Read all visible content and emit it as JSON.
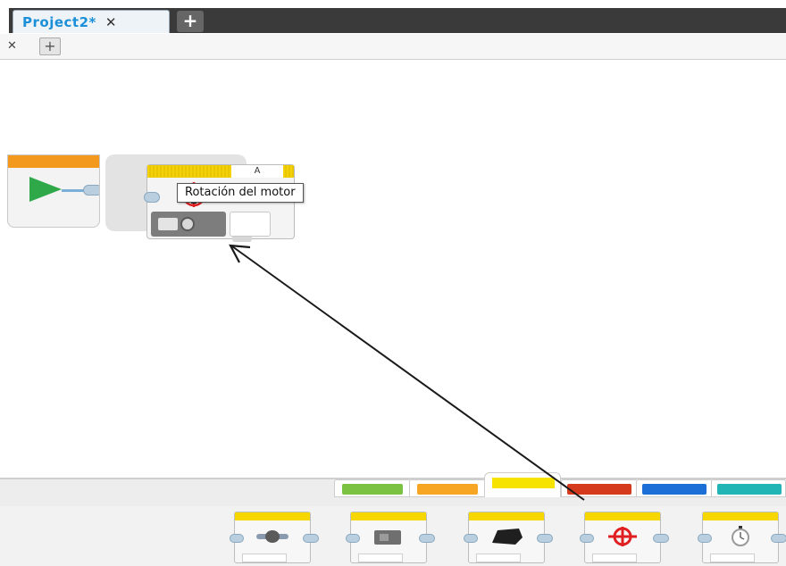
{
  "project_tabs": {
    "active_label": "Project2*",
    "close_glyph": "✕",
    "add_glyph": "+"
  },
  "program_tabs": {
    "close_glyph": "✕",
    "add_glyph": "+"
  },
  "canvas": {
    "start_block": {
      "icon": "play-icon"
    },
    "motor_block": {
      "port_label": "A",
      "icon": "motor-rotation-sensor-icon",
      "tooltip": "Rotación del motor"
    }
  },
  "palette": {
    "category_tabs": [
      {
        "name": "action",
        "color": "#7cc242"
      },
      {
        "name": "flow",
        "color": "#f6a623"
      },
      {
        "name": "sensor",
        "color": "#f6e400",
        "active": true
      },
      {
        "name": "data",
        "color": "#d63a1c"
      },
      {
        "name": "advanced",
        "color": "#1c6fd6"
      },
      {
        "name": "myblocks",
        "color": "#22b5b5"
      }
    ],
    "blocks": [
      {
        "icon": "brick-buttons-sensor-icon"
      },
      {
        "icon": "color-sensor-icon"
      },
      {
        "icon": "infrared-sensor-icon"
      },
      {
        "icon": "motor-rotation-sensor-icon"
      },
      {
        "icon": "timer-sensor-icon"
      }
    ]
  },
  "colors": {
    "accent_blue": "#1b8fd8",
    "start_orange": "#f39a1e",
    "play_green": "#2fa84a",
    "sensor_yellow": "#f6e400",
    "motor_red": "#e02020"
  }
}
